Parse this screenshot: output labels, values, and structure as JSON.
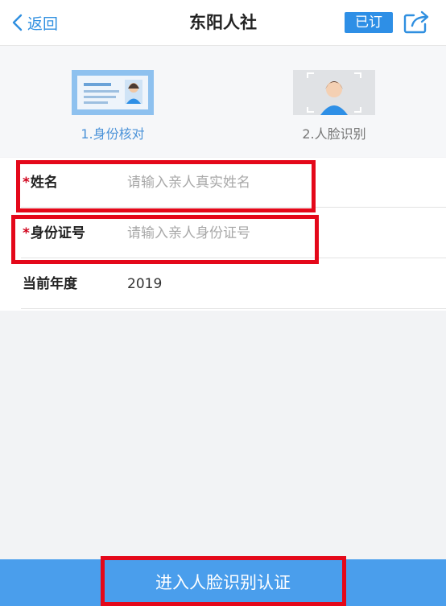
{
  "nav": {
    "back_label": "返回",
    "title": "东阳人社",
    "subscribed_label": "已订"
  },
  "steps": [
    {
      "label": "1.身份核对",
      "active": true
    },
    {
      "label": "2.人脸识别",
      "active": false
    }
  ],
  "form": {
    "name": {
      "required_mark": "*",
      "label": "姓名",
      "placeholder": "请输入亲人真实姓名",
      "value": ""
    },
    "id_number": {
      "required_mark": "*",
      "label": "身份证号",
      "placeholder": "请输入亲人身份证号",
      "value": ""
    },
    "year": {
      "label": "当前年度",
      "value": "2019"
    }
  },
  "submit": {
    "label": "进入人脸识别认证"
  },
  "colors": {
    "accent": "#2e8fe6",
    "submit_bg": "#4a9eec",
    "highlight": "#e4081a",
    "required": "#d0021b"
  }
}
